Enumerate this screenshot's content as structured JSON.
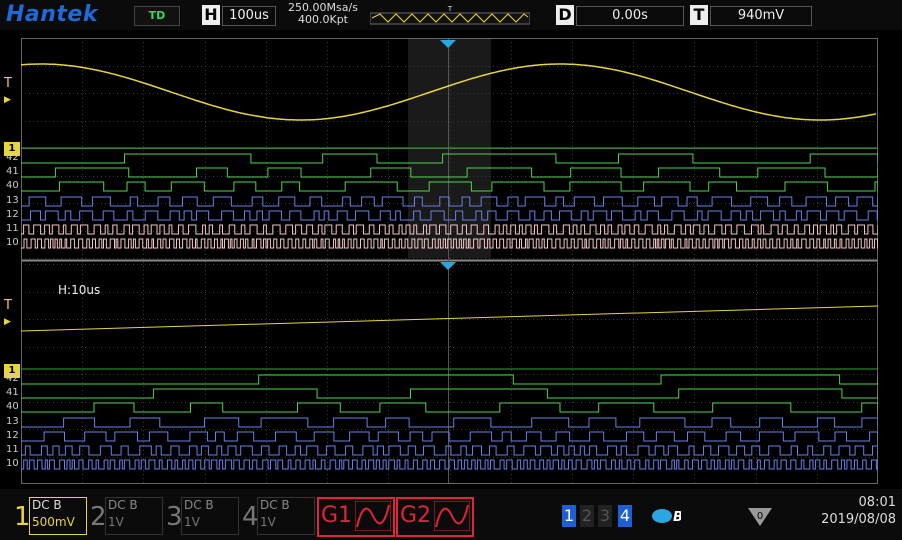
{
  "brand": "Hantek",
  "top": {
    "mode": "TD",
    "h_label": "H",
    "h_value": "100us",
    "sample_rate": "250.00Msa/s",
    "memory": "400.0Kpt",
    "trig_marker": "T",
    "d_label": "D",
    "d_value": "0.00s",
    "t_label": "T",
    "t_value": "940mV"
  },
  "screen": {
    "zoom_label": "H:10us",
    "trig_level_tag": "T",
    "digital_tag": "1",
    "rows_upper": [
      "42",
      "41",
      "40",
      "13",
      "12",
      "11",
      "10"
    ],
    "rows_lower": [
      "42",
      "41",
      "40",
      "13",
      "12",
      "11",
      "10"
    ]
  },
  "channels": [
    {
      "num": "1",
      "coupling": "DC",
      "bw": "B",
      "scale": "500mV",
      "active": true,
      "color": "#e6d63a"
    },
    {
      "num": "2",
      "coupling": "DC",
      "bw": "B",
      "scale": "1V",
      "active": false,
      "color": "#888"
    },
    {
      "num": "3",
      "coupling": "DC",
      "bw": "B",
      "scale": "1V",
      "active": false,
      "color": "#888"
    },
    {
      "num": "4",
      "coupling": "DC",
      "bw": "B",
      "scale": "1V",
      "active": false,
      "color": "#888"
    }
  ],
  "gens": [
    {
      "label": "G1"
    },
    {
      "label": "G2"
    }
  ],
  "pages": [
    "1",
    "2",
    "3",
    "4"
  ],
  "usb_icon": "B",
  "counter": "0",
  "clock": {
    "time": "08:01",
    "date": "2019/08/08"
  },
  "colors": {
    "ch1": "#e6d63a",
    "digital_green": "#4fd34f",
    "digital_blue": "#6a7fe8",
    "digital_pink": "#f2c6c6"
  }
}
